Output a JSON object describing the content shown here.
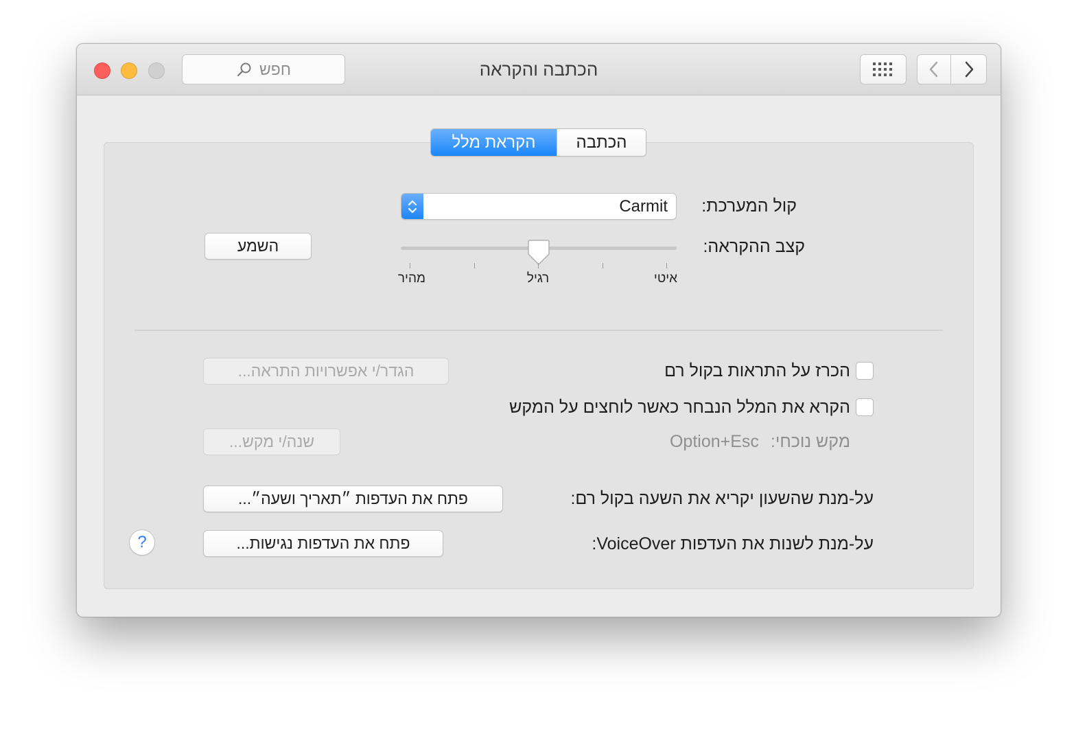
{
  "window": {
    "title": "הכתבה והקראה",
    "search_placeholder": "חפש"
  },
  "tabs": {
    "dictation": "הכתבה",
    "speech": "הקראת מלל",
    "selected": "הקראת מלל"
  },
  "voice": {
    "label": "קול המערכת:",
    "value": "Carmit"
  },
  "rate": {
    "label": "קצב ההקראה:",
    "slow": "איטי",
    "normal": "רגיל",
    "fast": "מהיר",
    "value_position": "רגיל",
    "play_button": "השמע"
  },
  "options": {
    "announce_alerts": {
      "label": "הכרז על התראות בקול רם",
      "checked": false,
      "button": "הגדר/י אפשרויות התראה..."
    },
    "speak_selected": {
      "label": "הקרא את המלל הנבחר כאשר לוחצים על המקש",
      "checked": false
    },
    "current_key": {
      "label": "מקש נוכחי:",
      "value": "Option+Esc",
      "button": "שנה/י מקש..."
    }
  },
  "clock": {
    "label": "על-מנת שהשעון יקריא את השעה בקול רם:",
    "button": "פתח את העדפות ״תאריך ושעה״..."
  },
  "voiceover": {
    "label": "על-מנת לשנות את העדפות VoiceOver:",
    "button": "פתח את העדפות נגישות..."
  },
  "help": {
    "glyph": "?"
  },
  "colors": {
    "accent": "#1b86fb",
    "close": "#fc605c",
    "minimize": "#fdbc40",
    "zoom_disabled": "#d0d0d0"
  },
  "icons": [
    "search-icon",
    "grid-icon",
    "chevron-left-icon",
    "chevron-right-icon",
    "stepper-arrows-icon",
    "help-icon"
  ]
}
